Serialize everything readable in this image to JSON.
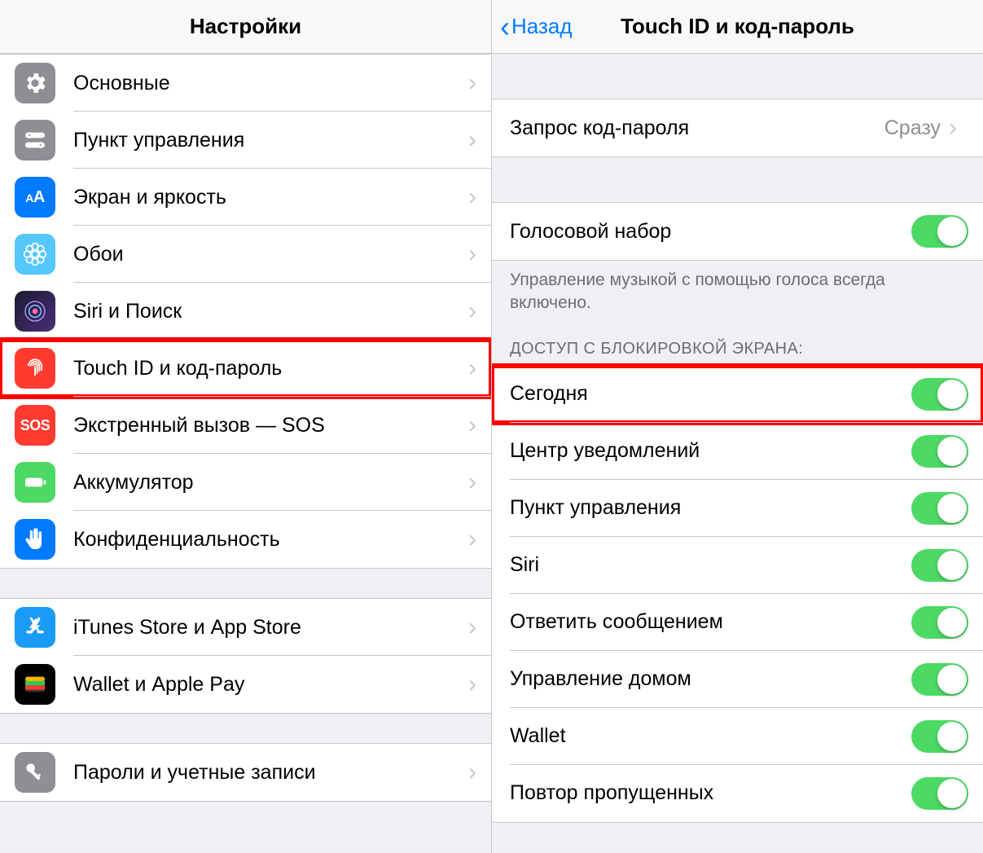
{
  "left": {
    "title": "Настройки",
    "groups": [
      {
        "items": [
          {
            "id": "general",
            "label": "Основные",
            "icon": "gear",
            "color": "gray"
          },
          {
            "id": "control-center",
            "label": "Пункт управления",
            "icon": "switches",
            "color": "gray"
          },
          {
            "id": "display",
            "label": "Экран и яркость",
            "icon": "aa",
            "color": "blue"
          },
          {
            "id": "wallpaper",
            "label": "Обои",
            "icon": "flower",
            "color": "teal"
          },
          {
            "id": "siri",
            "label": "Siri и Поиск",
            "icon": "siri",
            "color": "siri"
          },
          {
            "id": "touchid",
            "label": "Touch ID и код-пароль",
            "icon": "fingerprint",
            "color": "red",
            "highlight": true
          },
          {
            "id": "sos",
            "label": "Экстренный вызов — SOS",
            "icon": "sos",
            "color": "sos"
          },
          {
            "id": "battery",
            "label": "Аккумулятор",
            "icon": "battery",
            "color": "green"
          },
          {
            "id": "privacy",
            "label": "Конфиденциальность",
            "icon": "hand",
            "color": "hand"
          }
        ]
      },
      {
        "items": [
          {
            "id": "itunes",
            "label": "iTunes Store и App Store",
            "icon": "appstore",
            "color": "appstore"
          },
          {
            "id": "wallet",
            "label": "Wallet и Apple Pay",
            "icon": "wallet",
            "color": "black"
          }
        ]
      },
      {
        "items": [
          {
            "id": "passwords",
            "label": "Пароли и учетные записи",
            "icon": "key",
            "color": "key"
          }
        ]
      }
    ]
  },
  "right": {
    "back_label": "Назад",
    "title": "Touch ID и код-пароль",
    "require_passcode_label": "Запрос код-пароля",
    "require_passcode_value": "Сразу",
    "voice_dial_label": "Голосовой набор",
    "voice_dial_on": true,
    "voice_dial_footer": "Управление музыкой с помощью голоса всегда включено.",
    "lock_access_header": "ДОСТУП С БЛОКИРОВКОЙ ЭКРАНА:",
    "lock_items": [
      {
        "id": "today",
        "label": "Сегодня",
        "on": true,
        "highlight": true
      },
      {
        "id": "notif",
        "label": "Центр уведомлений",
        "on": true
      },
      {
        "id": "cc",
        "label": "Пункт управления",
        "on": true
      },
      {
        "id": "siri",
        "label": "Siri",
        "on": true
      },
      {
        "id": "reply",
        "label": "Ответить сообщением",
        "on": true
      },
      {
        "id": "home",
        "label": "Управление домом",
        "on": true
      },
      {
        "id": "wallet",
        "label": "Wallet",
        "on": true
      },
      {
        "id": "return-missed",
        "label": "Повтор пропущенных",
        "on": true
      }
    ]
  }
}
